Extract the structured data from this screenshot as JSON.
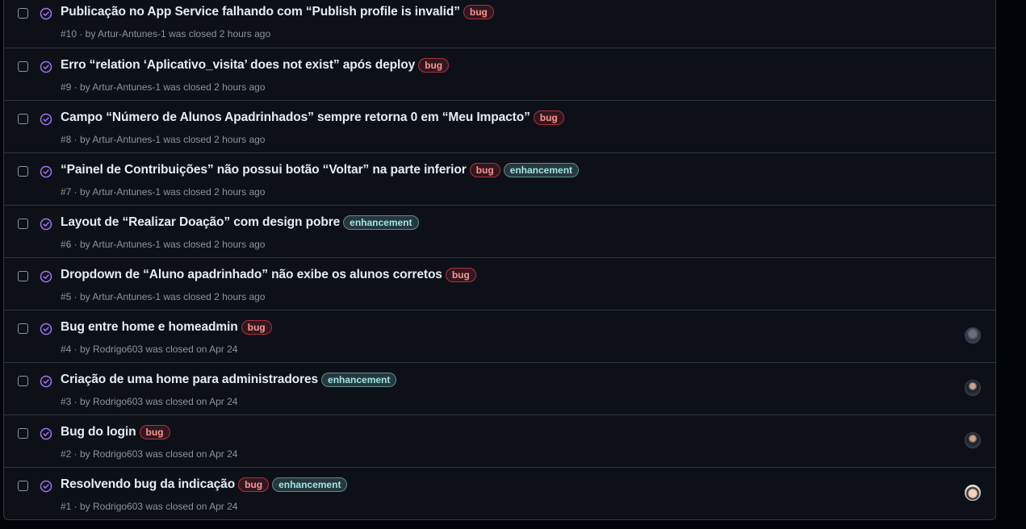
{
  "issues": [
    {
      "title": "Publicação no App Service falhando com “Publish profile is invalid”",
      "meta": "#10 · by Artur-Antunes-1 was closed 2 hours ago",
      "labels": [
        "bug"
      ],
      "avatar": ""
    },
    {
      "title": "Erro “relation ‘Aplicativo_visita’ does not exist” após deploy",
      "meta": "#9 · by Artur-Antunes-1 was closed 2 hours ago",
      "labels": [
        "bug"
      ],
      "avatar": ""
    },
    {
      "title": "Campo “Número de Alunos Apadrinhados” sempre retorna 0 em “Meu Impacto”",
      "meta": "#8 · by Artur-Antunes-1 was closed 2 hours ago",
      "labels": [
        "bug"
      ],
      "avatar": ""
    },
    {
      "title": "“Painel de Contribuições” não possui botão “Voltar” na parte inferior",
      "meta": "#7 · by Artur-Antunes-1 was closed 2 hours ago",
      "labels": [
        "bug",
        "enhancement"
      ],
      "avatar": ""
    },
    {
      "title": "Layout de “Realizar Doação” com design pobre",
      "meta": "#6 · by Artur-Antunes-1 was closed 2 hours ago",
      "labels": [
        "enhancement"
      ],
      "avatar": ""
    },
    {
      "title": "Dropdown de “Aluno apadrinhado” não exibe os alunos corretos",
      "meta": "#5 · by Artur-Antunes-1 was closed 2 hours ago",
      "labels": [
        "bug"
      ],
      "avatar": ""
    },
    {
      "title": "Bug entre home e homeadmin",
      "meta": "#4 · by Rodrigo603 was closed on Apr 24",
      "labels": [
        "bug"
      ],
      "avatar": "a"
    },
    {
      "title": "Criação de uma home para administradores",
      "meta": "#3 · by Rodrigo603 was closed on Apr 24",
      "labels": [
        "enhancement"
      ],
      "avatar": "b"
    },
    {
      "title": "Bug do login",
      "meta": "#2 · by Rodrigo603 was closed on Apr 24",
      "labels": [
        "bug"
      ],
      "avatar": "b"
    },
    {
      "title": "Resolvendo bug da indicação",
      "meta": "#1 · by Rodrigo603 was closed on Apr 24",
      "labels": [
        "bug",
        "enhancement"
      ],
      "avatar": "c"
    }
  ],
  "icons": {
    "status": "issue-closed-completed-icon",
    "checkbox": "select-checkbox"
  },
  "colors": {
    "closed_purple": "#a371f7",
    "bug_text": "#ff9492",
    "enhancement_text": "#9de6e4"
  }
}
